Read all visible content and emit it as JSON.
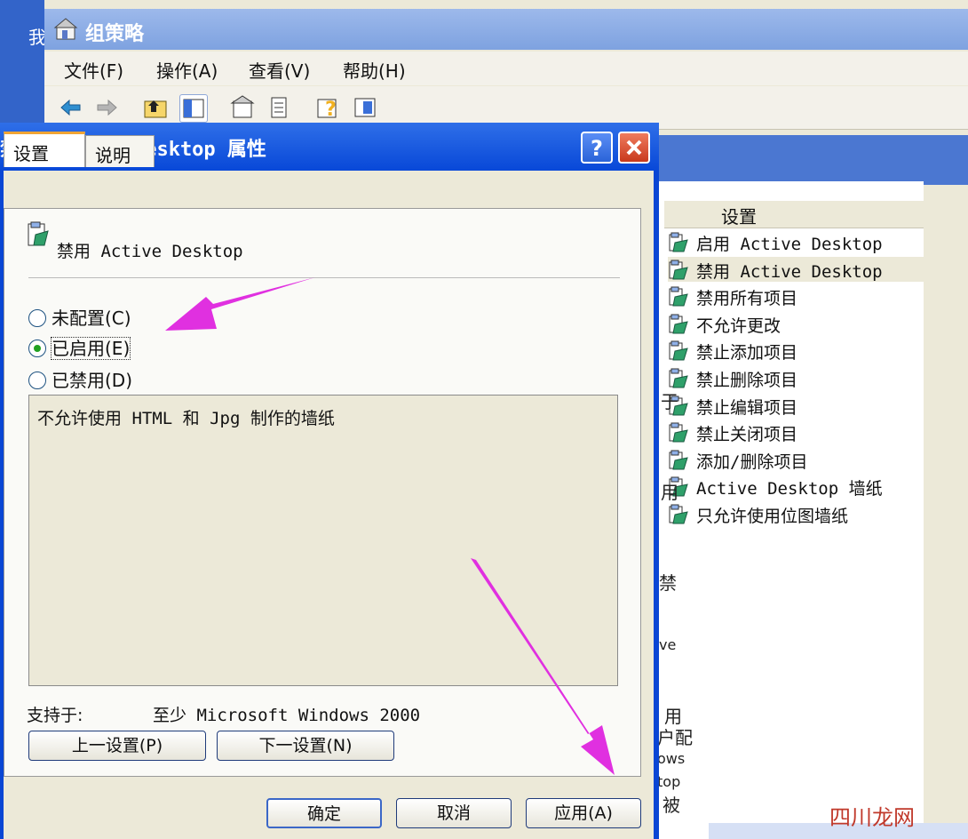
{
  "left_window": {
    "title_fragment": "我"
  },
  "main_window": {
    "title": "组策略",
    "menu": [
      "文件(F)",
      "操作(A)",
      "查看(V)",
      "帮助(H)"
    ],
    "toolbar_icons": [
      "back-arrow-icon",
      "forward-arrow-icon",
      "up-folder-icon",
      "show-tree-icon",
      "properties-icon",
      "export-list-icon",
      "help-icon",
      "panel-icon"
    ],
    "list_header": "设置",
    "list_items": [
      "启用 Active Desktop",
      "禁用 Active Desktop",
      "禁用所有项目",
      "不允许更改",
      "禁止添加项目",
      "禁止删除项目",
      "禁止编辑项目",
      "禁止关闭项目",
      "添加/删除项目",
      "Active Desktop 墙纸",
      "只允许使用位图墙纸"
    ],
    "selected_index": 1,
    "behind_text": [
      "于",
      "用",
      "禁",
      "ve",
      "用",
      "户配",
      "ows",
      "top",
      "被"
    ]
  },
  "dialog": {
    "title": "禁用 Active Desktop 属性",
    "help_label": "?",
    "tabs": [
      "设置",
      "说明"
    ],
    "policy_name": "禁用 Active Desktop",
    "options": [
      "未配置(C)",
      "已启用(E)",
      "已禁用(D)"
    ],
    "selected_option": 1,
    "comment": "不允许使用 HTML 和 Jpg 制作的墙纸",
    "supported_label": "支持于:",
    "supported_value": "至少 Microsoft Windows 2000",
    "prev_button": "上一设置(P)",
    "next_button": "下一设置(N)",
    "ok_button": "确定",
    "cancel_button": "取消",
    "apply_button": "应用(A)"
  },
  "watermark": "四川龙网",
  "colors": {
    "annotation_arrow": "#e030e0",
    "title_blue": "#0a46d4",
    "enabled_radio": "#21a121"
  }
}
